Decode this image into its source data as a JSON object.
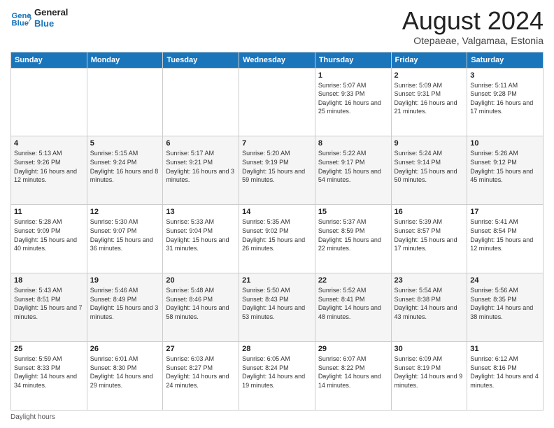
{
  "logo": {
    "line1": "General",
    "line2": "Blue"
  },
  "title": "August 2024",
  "subtitle": "Otepaeae, Valgamaa, Estonia",
  "days_header": [
    "Sunday",
    "Monday",
    "Tuesday",
    "Wednesday",
    "Thursday",
    "Friday",
    "Saturday"
  ],
  "weeks": [
    [
      {
        "day": "",
        "info": ""
      },
      {
        "day": "",
        "info": ""
      },
      {
        "day": "",
        "info": ""
      },
      {
        "day": "",
        "info": ""
      },
      {
        "day": "1",
        "info": "Sunrise: 5:07 AM\nSunset: 9:33 PM\nDaylight: 16 hours and 25 minutes."
      },
      {
        "day": "2",
        "info": "Sunrise: 5:09 AM\nSunset: 9:31 PM\nDaylight: 16 hours and 21 minutes."
      },
      {
        "day": "3",
        "info": "Sunrise: 5:11 AM\nSunset: 9:28 PM\nDaylight: 16 hours and 17 minutes."
      }
    ],
    [
      {
        "day": "4",
        "info": "Sunrise: 5:13 AM\nSunset: 9:26 PM\nDaylight: 16 hours and 12 minutes."
      },
      {
        "day": "5",
        "info": "Sunrise: 5:15 AM\nSunset: 9:24 PM\nDaylight: 16 hours and 8 minutes."
      },
      {
        "day": "6",
        "info": "Sunrise: 5:17 AM\nSunset: 9:21 PM\nDaylight: 16 hours and 3 minutes."
      },
      {
        "day": "7",
        "info": "Sunrise: 5:20 AM\nSunset: 9:19 PM\nDaylight: 15 hours and 59 minutes."
      },
      {
        "day": "8",
        "info": "Sunrise: 5:22 AM\nSunset: 9:17 PM\nDaylight: 15 hours and 54 minutes."
      },
      {
        "day": "9",
        "info": "Sunrise: 5:24 AM\nSunset: 9:14 PM\nDaylight: 15 hours and 50 minutes."
      },
      {
        "day": "10",
        "info": "Sunrise: 5:26 AM\nSunset: 9:12 PM\nDaylight: 15 hours and 45 minutes."
      }
    ],
    [
      {
        "day": "11",
        "info": "Sunrise: 5:28 AM\nSunset: 9:09 PM\nDaylight: 15 hours and 40 minutes."
      },
      {
        "day": "12",
        "info": "Sunrise: 5:30 AM\nSunset: 9:07 PM\nDaylight: 15 hours and 36 minutes."
      },
      {
        "day": "13",
        "info": "Sunrise: 5:33 AM\nSunset: 9:04 PM\nDaylight: 15 hours and 31 minutes."
      },
      {
        "day": "14",
        "info": "Sunrise: 5:35 AM\nSunset: 9:02 PM\nDaylight: 15 hours and 26 minutes."
      },
      {
        "day": "15",
        "info": "Sunrise: 5:37 AM\nSunset: 8:59 PM\nDaylight: 15 hours and 22 minutes."
      },
      {
        "day": "16",
        "info": "Sunrise: 5:39 AM\nSunset: 8:57 PM\nDaylight: 15 hours and 17 minutes."
      },
      {
        "day": "17",
        "info": "Sunrise: 5:41 AM\nSunset: 8:54 PM\nDaylight: 15 hours and 12 minutes."
      }
    ],
    [
      {
        "day": "18",
        "info": "Sunrise: 5:43 AM\nSunset: 8:51 PM\nDaylight: 15 hours and 7 minutes."
      },
      {
        "day": "19",
        "info": "Sunrise: 5:46 AM\nSunset: 8:49 PM\nDaylight: 15 hours and 3 minutes."
      },
      {
        "day": "20",
        "info": "Sunrise: 5:48 AM\nSunset: 8:46 PM\nDaylight: 14 hours and 58 minutes."
      },
      {
        "day": "21",
        "info": "Sunrise: 5:50 AM\nSunset: 8:43 PM\nDaylight: 14 hours and 53 minutes."
      },
      {
        "day": "22",
        "info": "Sunrise: 5:52 AM\nSunset: 8:41 PM\nDaylight: 14 hours and 48 minutes."
      },
      {
        "day": "23",
        "info": "Sunrise: 5:54 AM\nSunset: 8:38 PM\nDaylight: 14 hours and 43 minutes."
      },
      {
        "day": "24",
        "info": "Sunrise: 5:56 AM\nSunset: 8:35 PM\nDaylight: 14 hours and 38 minutes."
      }
    ],
    [
      {
        "day": "25",
        "info": "Sunrise: 5:59 AM\nSunset: 8:33 PM\nDaylight: 14 hours and 34 minutes."
      },
      {
        "day": "26",
        "info": "Sunrise: 6:01 AM\nSunset: 8:30 PM\nDaylight: 14 hours and 29 minutes."
      },
      {
        "day": "27",
        "info": "Sunrise: 6:03 AM\nSunset: 8:27 PM\nDaylight: 14 hours and 24 minutes."
      },
      {
        "day": "28",
        "info": "Sunrise: 6:05 AM\nSunset: 8:24 PM\nDaylight: 14 hours and 19 minutes."
      },
      {
        "day": "29",
        "info": "Sunrise: 6:07 AM\nSunset: 8:22 PM\nDaylight: 14 hours and 14 minutes."
      },
      {
        "day": "30",
        "info": "Sunrise: 6:09 AM\nSunset: 8:19 PM\nDaylight: 14 hours and 9 minutes."
      },
      {
        "day": "31",
        "info": "Sunrise: 6:12 AM\nSunset: 8:16 PM\nDaylight: 14 hours and 4 minutes."
      }
    ]
  ],
  "footer": "Daylight hours"
}
